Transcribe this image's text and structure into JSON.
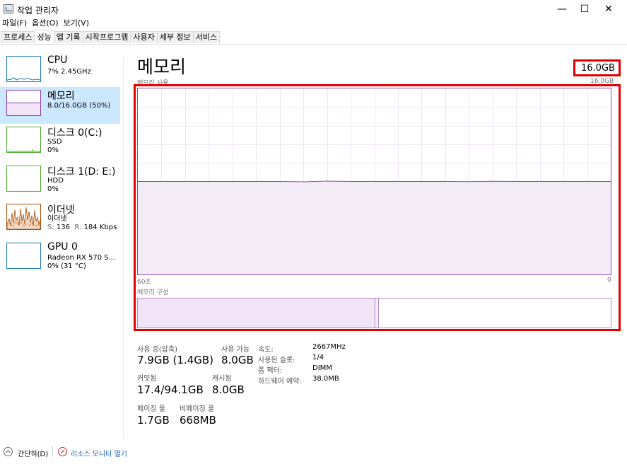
{
  "window": {
    "title": "작업 관리자",
    "minimize": "—",
    "maximize": "☐",
    "close": "✕"
  },
  "menu": [
    "파일(F)",
    "옵션(O)",
    "보기(V)"
  ],
  "tabs": [
    {
      "label": "프로세스",
      "active": false
    },
    {
      "label": "성능",
      "active": true
    },
    {
      "label": "앱 기록",
      "active": false
    },
    {
      "label": "시작프로그램",
      "active": false
    },
    {
      "label": "사용자",
      "active": false
    },
    {
      "label": "세부 정보",
      "active": false
    },
    {
      "label": "서비스",
      "active": false
    }
  ],
  "sidebar": {
    "items": [
      {
        "title": "CPU",
        "sub1": "7% 2.45GHz",
        "sub2": "",
        "sub3": "",
        "color": "#1a7ab7"
      },
      {
        "title": "메모리",
        "sub1": "8.0/16.0GB (50%)",
        "sub2": "",
        "sub3": "",
        "color": "#8b3fa8"
      },
      {
        "title": "디스크 0(C:)",
        "sub1": "SSD",
        "sub2": "0%",
        "sub3": "",
        "color": "#4caa2b"
      },
      {
        "title": "디스크 1(D: E:)",
        "sub1": "HDD",
        "sub2": "0%",
        "sub3": "",
        "color": "#4caa2b"
      },
      {
        "title": "이더넷",
        "sub1": "이더넷",
        "sub2": "",
        "sub3": "",
        "color": "#a74f0c",
        "send_label": "S:",
        "send_val": "136",
        "recv_label": "R:",
        "recv_val": "184 Kbps"
      },
      {
        "title": "GPU 0",
        "sub1": "Radeon RX 570 S...",
        "sub2": "0% (31 °C)",
        "sub3": "",
        "color": "#1a7ab7"
      }
    ]
  },
  "main": {
    "title": "메모리",
    "total": "16.0GB",
    "graph_label": "메모리 사용",
    "graph_max": "16.0GB",
    "graph_time_left": "60초",
    "graph_time_right": "0",
    "usage_fraction": 0.5,
    "composition_label": "메모리 구성",
    "composition_in_use_fraction": 0.5
  },
  "stats": {
    "in_use_label": "사용 중(압축)",
    "in_use_val": "7.9GB (1.4GB)",
    "available_label": "사용 가능",
    "available_val": "8.0GB",
    "committed_label": "커밋됨",
    "committed_val": "17.4/94.1GB",
    "cached_label": "캐시됨",
    "cached_val": "8.0GB",
    "paged_label": "페이징 풀",
    "paged_val": "1.7GB",
    "nonpaged_label": "비페이징 풀",
    "nonpaged_val": "668MB"
  },
  "info": [
    {
      "label": "속도:",
      "value": "2667MHz"
    },
    {
      "label": "사용된 슬롯:",
      "value": "1/4"
    },
    {
      "label": "폼 팩터:",
      "value": "DIMM"
    },
    {
      "label": "하드웨어 예약:",
      "value": "38.0MB"
    }
  ],
  "footer": {
    "collapse_label": "간단히(D)",
    "monitor_label": "리소스 모니터 열기"
  },
  "colors": {
    "memory": "#8b4aa5",
    "highlight": "#e00000",
    "selected": "#cce8ff"
  }
}
